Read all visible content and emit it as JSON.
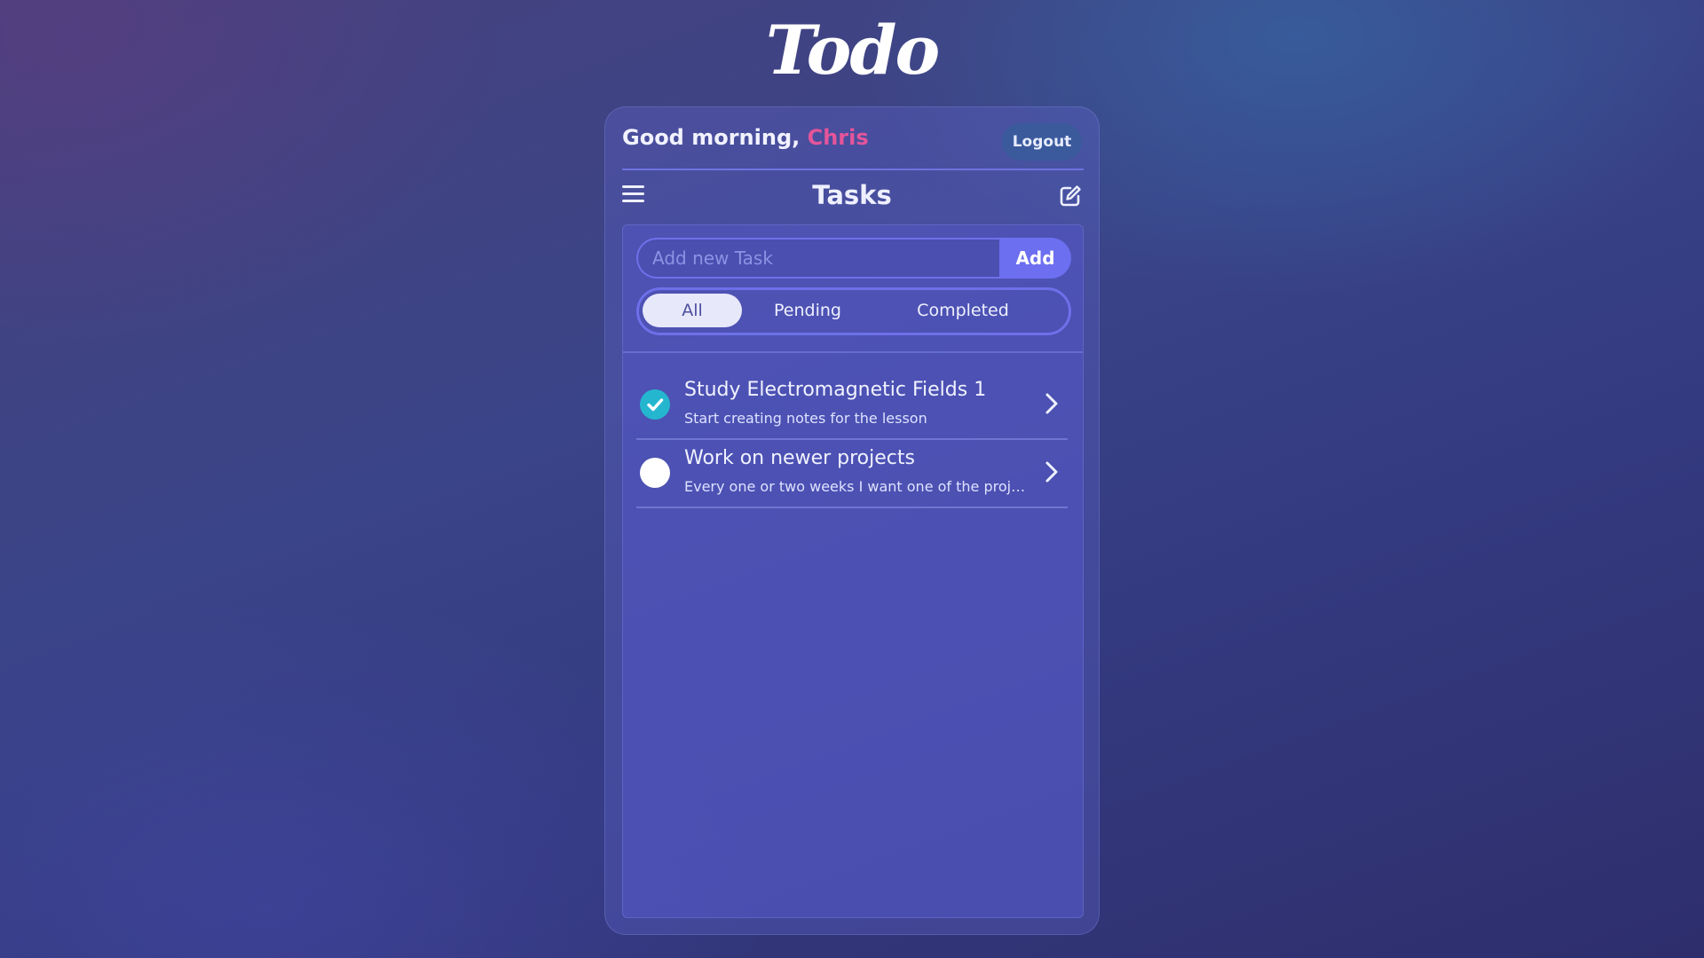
{
  "app": {
    "brand": "Todo"
  },
  "header": {
    "greeting": "Good morning,",
    "user_name": "Chris",
    "logout_label": "Logout"
  },
  "toolbar": {
    "title": "Tasks",
    "menu_icon": "hamburger-menu-icon",
    "edit_icon": "edit-icon"
  },
  "add_task": {
    "placeholder": "Add new Task",
    "value": "",
    "button_label": "Add"
  },
  "filters": {
    "items": [
      {
        "label": "All",
        "active": true
      },
      {
        "label": "Pending",
        "active": false
      },
      {
        "label": "Completed",
        "active": false
      }
    ]
  },
  "tasks": [
    {
      "title": "Study Electromagnetic Fields 1",
      "description": "Start creating notes for the lesson",
      "completed": true
    },
    {
      "title": "Work on newer projects",
      "description": "Every one or two weeks I want one of the projects",
      "completed": false
    }
  ],
  "colors": {
    "accent": "#6c6ff0",
    "user_highlight": "#e4559a",
    "check_done": "#25b6cf",
    "logout_bg": "#3a5a9c"
  }
}
